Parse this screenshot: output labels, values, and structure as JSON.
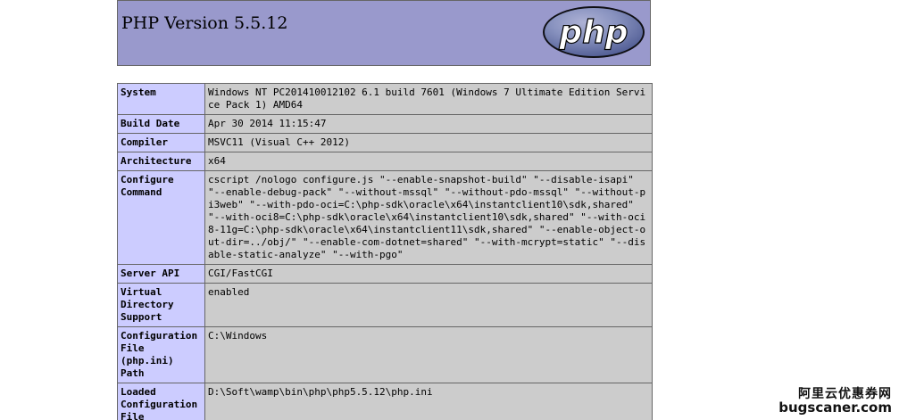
{
  "header": {
    "title": "PHP Version 5.5.12",
    "logo_text": "php"
  },
  "rows": [
    {
      "key": "System",
      "value": "Windows NT PC201410012102 6.1 build 7601 (Windows 7 Ultimate Edition Service Pack 1) AMD64"
    },
    {
      "key": "Build Date",
      "value": "Apr 30 2014 11:15:47"
    },
    {
      "key": "Compiler",
      "value": "MSVC11 (Visual C++ 2012)"
    },
    {
      "key": "Architecture",
      "value": "x64"
    },
    {
      "key": "Configure Command",
      "value": "cscript /nologo configure.js \"--enable-snapshot-build\" \"--disable-isapi\" \"--enable-debug-pack\" \"--without-mssql\" \"--without-pdo-mssql\" \"--without-pi3web\" \"--with-pdo-oci=C:\\php-sdk\\oracle\\x64\\instantclient10\\sdk,shared\" \"--with-oci8=C:\\php-sdk\\oracle\\x64\\instantclient10\\sdk,shared\" \"--with-oci8-11g=C:\\php-sdk\\oracle\\x64\\instantclient11\\sdk,shared\" \"--enable-object-out-dir=../obj/\" \"--enable-com-dotnet=shared\" \"--with-mcrypt=static\" \"--disable-static-analyze\" \"--with-pgo\""
    },
    {
      "key": "Server API",
      "value": "CGI/FastCGI"
    },
    {
      "key": "Virtual Directory Support",
      "value": "enabled"
    },
    {
      "key": "Configuration File (php.ini) Path",
      "value": "C:\\Windows"
    },
    {
      "key": "Loaded Configuration File",
      "value": "D:\\Soft\\wamp\\bin\\php\\php5.5.12\\php.ini"
    }
  ],
  "watermark": {
    "line1": "阿里云优惠券网",
    "line2": "bugscaner.com"
  },
  "colors": {
    "header_bg": "#9999cc",
    "key_bg": "#ccccff",
    "value_bg": "#cccccc",
    "logo_bg": "#6c7eb7"
  }
}
